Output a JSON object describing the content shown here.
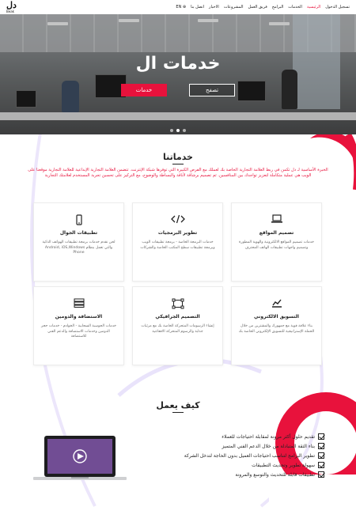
{
  "header": {
    "logo_mark": "دل",
    "logo_word": "Beak",
    "nav": [
      {
        "label": "تسجيل الدخول",
        "active": false
      },
      {
        "label": "الرئيسية",
        "active": true
      },
      {
        "label": "الخدمات",
        "active": false
      },
      {
        "label": "البرامج",
        "active": false
      },
      {
        "label": "فريق العمل",
        "active": false
      },
      {
        "label": "المشروعات",
        "active": false
      },
      {
        "label": "الاخبار",
        "active": false
      },
      {
        "label": "اتصل بنا",
        "active": false
      },
      {
        "label": "EN",
        "active": false
      }
    ]
  },
  "hero": {
    "title": "خدمات ال",
    "browse_button": "تصفح",
    "services_button": "خدمات"
  },
  "services": {
    "title": "خدماتنا",
    "intro": "الخبرة الأساسية لـ دل تكمن في ربط العلامة التجارية الخاصة بك لعملك مع الفرص الكبيرة التي توفرها شبكة الإنترنت. تتضمن العلامة التجارية الإبداعية للعلامة التجارية موقعنا على الويب هي عملية متكاملة لتعزيز تواجدك بين المنافسين. ثم تصميم برشاقة لأناقة والبساطة والوضوح، مع التركيز على تحسين تجربة المستخدم لعلامتك التجارية",
    "cards": [
      {
        "icon": "laptop-icon",
        "glyph": "💻",
        "title": "تصميم المواقع",
        "desc": "خدمات تصميم المواقع الالكترونية والهوية المطورة وتصميم واجهات تطبيقات الهاتف المحترف"
      },
      {
        "icon": "code-icon",
        "glyph": "</>",
        "title": "تطوير البرمجيات",
        "desc": "خدمات البرمجة الخاصة - برمجة تطبيقات الويب وبرمجة تطبيقات سطح المكتب الخاصة والشركات"
      },
      {
        "icon": "mobile-icon",
        "glyph": "▯",
        "title": "تطبيقات الجوال",
        "desc": "لحن نقدم خدمات برمجة تطبيقات الهواتف الذكية والتي تعمل بنظام Android, iOS,Windows Phone"
      },
      {
        "icon": "chart-icon",
        "glyph": "📈",
        "title": "التسويق الالكتروني",
        "desc": "بناء علاقة قوية مع جمهورك والمشترين من خلال الحملة الإستراتيجية للتسويق الإلكتروني الخاصة بك"
      },
      {
        "icon": "vector-icon",
        "glyph": "⬚",
        "title": "التصميم الجرافيكي",
        "desc": "إنشاء الرسومات المتحركة الخاصة بك مع مرئيات جذابة والرسوم المتحركة الافعاعية"
      },
      {
        "icon": "server-icon",
        "glyph": "▤",
        "title": "الاستضافة والدومين",
        "desc": "خدمات الحوسبة السحابية - الخوادم - خدمات حجز الدومين وخدمات الاستضافة والدعم الفني للاستضافة"
      }
    ]
  },
  "how": {
    "title": "كيف يعمل",
    "points": [
      "تقديم حلول أكثر مرونة لمقابلة احتياجات للعملاء",
      "بناء الثقة المتبادلة من خلال الدعم الفني المتميز",
      "تطوير البرامج لتناسب احتياجات العميل بدون الحاجة لتدخل الشركة",
      "سهولة تطوير وتحديث التطبيقات",
      "تطبيقات قابلة للتحديث والتوسع والمرونة"
    ]
  },
  "colors": {
    "accent": "#e8123c",
    "text": "#222222"
  }
}
